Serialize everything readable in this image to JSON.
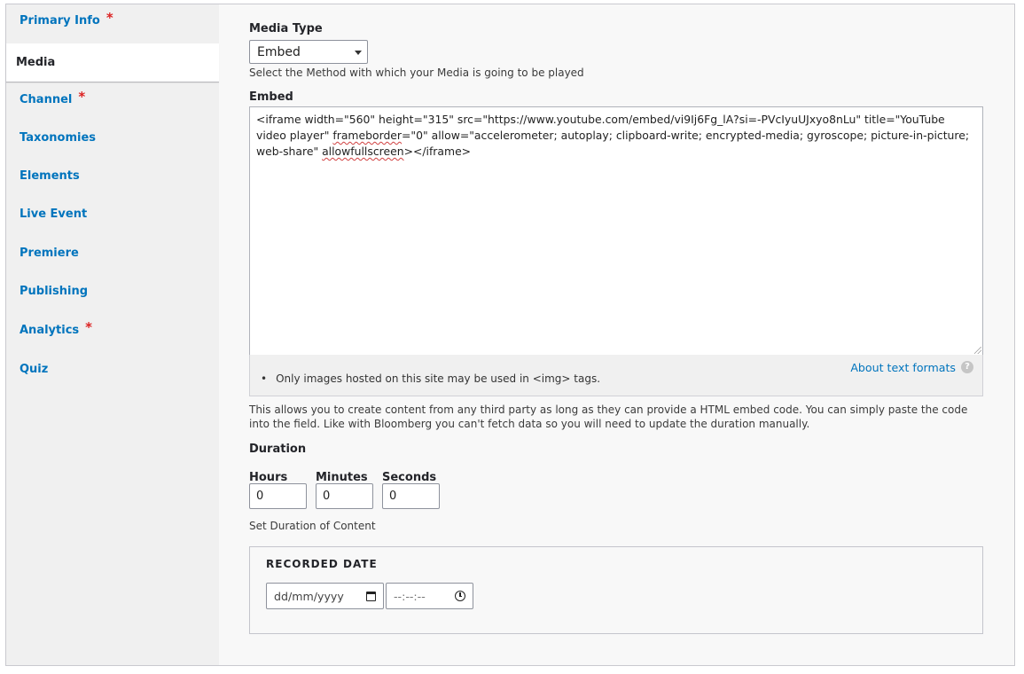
{
  "tabs": {
    "primary_info": "Primary Info",
    "media": "Media",
    "channel": "Channel",
    "taxonomies": "Taxonomies",
    "elements": "Elements",
    "live_event": "Live Event",
    "premiere": "Premiere",
    "publishing": "Publishing",
    "analytics": "Analytics",
    "quiz": "Quiz",
    "required_marker": "*"
  },
  "media_type": {
    "label": "Media Type",
    "selected": "Embed",
    "description": "Select the Method with which your Media is going to be played"
  },
  "embed": {
    "label": "Embed",
    "code_part1": "<iframe width=\"560\" height=\"315\" src=\"https://www.youtube.com/embed/vi9Ij6Fg_lA?si=-PVcIyuUJxyo8nLu\" title=\"YouTube video player\" ",
    "code_word_frameborder": "frameborder",
    "code_part2": "=\"0\" allow=\"accelerometer; autoplay; clipboard-write; encrypted-media; gyroscope; picture-in-picture; web-share\" ",
    "code_word_allowfullscreen": "allowfullscreen",
    "code_part3": "></iframe>",
    "format_rule": "Only images hosted on this site may be used in <img> tags.",
    "about_formats": "About text formats",
    "help_glyph": "?",
    "description": "This allows you to create content from any third party as long as they can provide a HTML embed code. You can simply paste the code into the field. Like with Bloomberg you can't fetch data so you will need to update the duration manually."
  },
  "duration": {
    "label": "Duration",
    "hours_label": "Hours",
    "hours_value": "0",
    "minutes_label": "Minutes",
    "minutes_value": "0",
    "seconds_label": "Seconds",
    "seconds_value": "0",
    "description": "Set Duration of Content"
  },
  "recorded_date": {
    "legend": "RECORDED DATE",
    "date_placeholder": "dd/mm/yyyy",
    "time_placeholder": "--:--:--"
  },
  "colors": {
    "link": "#0074bd",
    "required": "#dc2323",
    "tab_background": "#f0f0f0",
    "page_background": "#f8f8f8"
  }
}
